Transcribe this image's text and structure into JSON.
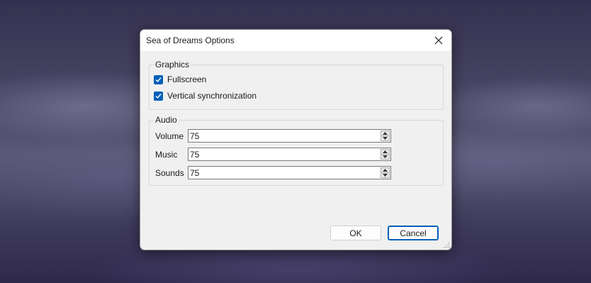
{
  "dialog": {
    "title": "Sea of Dreams Options",
    "close_icon": "close-icon"
  },
  "graphics": {
    "label": "Graphics",
    "fullscreen": {
      "label": "Fullscreen",
      "checked": true
    },
    "vsync": {
      "label": "Vertical synchronization",
      "checked": true
    }
  },
  "audio": {
    "label": "Audio",
    "fields": [
      {
        "label": "Volume",
        "value": "75"
      },
      {
        "label": "Music",
        "value": "75"
      },
      {
        "label": "Sounds",
        "value": "75"
      }
    ]
  },
  "buttons": {
    "ok": "OK",
    "cancel": "Cancel"
  },
  "colors": {
    "accent": "#005fb8"
  }
}
